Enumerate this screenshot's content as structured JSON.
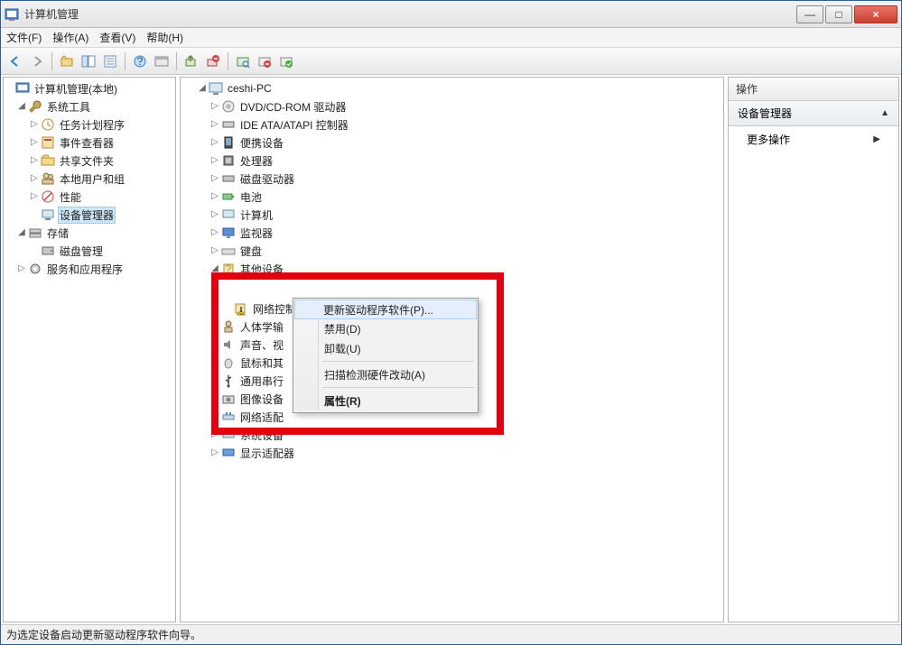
{
  "window": {
    "title": "计算机管理"
  },
  "win_btns": {
    "min": "—",
    "max": "□",
    "close": "×"
  },
  "menu": {
    "file": "文件(F)",
    "action": "操作(A)",
    "view": "查看(V)",
    "help": "帮助(H)"
  },
  "left_tree": {
    "root": "计算机管理(本地)",
    "system_tools": "系统工具",
    "task_scheduler": "任务计划程序",
    "event_viewer": "事件查看器",
    "shared_folders": "共享文件夹",
    "local_users": "本地用户和组",
    "performance": "性能",
    "device_manager": "设备管理器",
    "storage": "存储",
    "disk_mgmt": "磁盘管理",
    "services_apps": "服务和应用程序"
  },
  "center_tree": {
    "root": "ceshi-PC",
    "dvd": "DVD/CD-ROM 驱动器",
    "ide": "IDE ATA/ATAPI 控制器",
    "portable": "便携设备",
    "cpu": "处理器",
    "disk_drives": "磁盘驱动器",
    "battery": "电池",
    "computer": "计算机",
    "monitors": "监视器",
    "keyboard": "键盘",
    "other_devices": "其他设备",
    "network_controller": "网络控制器",
    "hid": "人体学输",
    "sound": "声音、视",
    "mouse": "鼠标和其",
    "usb": "通用串行",
    "imaging": "图像设备",
    "net_adapters": "网络适配",
    "system_devices": "系统设备",
    "display_adapters": "显示适配器"
  },
  "context_menu": {
    "update": "更新驱动程序软件(P)...",
    "disable": "禁用(D)",
    "uninstall": "卸载(U)",
    "scan": "扫描检测硬件改动(A)",
    "properties": "属性(R)"
  },
  "right": {
    "header": "操作",
    "section": "设备管理器",
    "more": "更多操作"
  },
  "status": "为选定设备启动更新驱动程序软件向导。"
}
